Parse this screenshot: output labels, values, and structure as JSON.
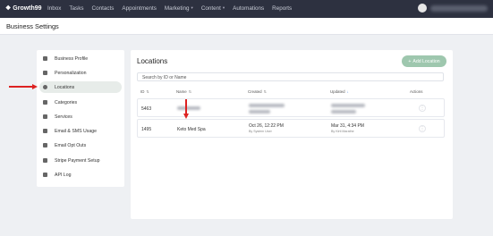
{
  "app": {
    "logo": "Growth99"
  },
  "nav": {
    "items": [
      "Inbox",
      "Tasks",
      "Contacts",
      "Appointments",
      "Marketing",
      "Content",
      "Automations",
      "Reports"
    ]
  },
  "page": {
    "title": "Business Settings"
  },
  "sidebar": {
    "items": [
      {
        "label": "Business Profile",
        "icon": "building-icon"
      },
      {
        "label": "Personalization",
        "icon": "brush-icon"
      },
      {
        "label": "Locations",
        "icon": "location-pin-icon",
        "active": true
      },
      {
        "label": "Categories",
        "icon": "tag-icon"
      },
      {
        "label": "Services",
        "icon": "briefcase-icon"
      },
      {
        "label": "Email & SMS Usage",
        "icon": "mail-icon"
      },
      {
        "label": "Email Opt Outs",
        "icon": "opt-out-icon"
      },
      {
        "label": "Stripe Payment Setup",
        "icon": "card-icon"
      },
      {
        "label": "API Log",
        "icon": "log-icon"
      }
    ]
  },
  "locations": {
    "heading": "Locations",
    "add_label": "Add Location",
    "search_placeholder": "Search by ID or Name",
    "columns": {
      "id": "ID",
      "name": "Name",
      "created": "Created",
      "updated": "Updated",
      "actions": "Actions"
    },
    "rows": [
      {
        "id": "5463",
        "name": "",
        "created": "",
        "created_by": "",
        "updated": "",
        "updated_by": ""
      },
      {
        "id": "1495",
        "name": "Keto Med Spa",
        "created": "Oct 26, 12:22 PM",
        "created_by": "By System User",
        "updated": "Mar 31, 4:34 PM",
        "updated_by": "By Kirti Marathe"
      }
    ]
  },
  "colors": {
    "topbar": "#2d3140",
    "accent_button": "#9ec7ae",
    "annotation_arrow": "#dd2222",
    "sort_active": "#3b7ddd"
  }
}
